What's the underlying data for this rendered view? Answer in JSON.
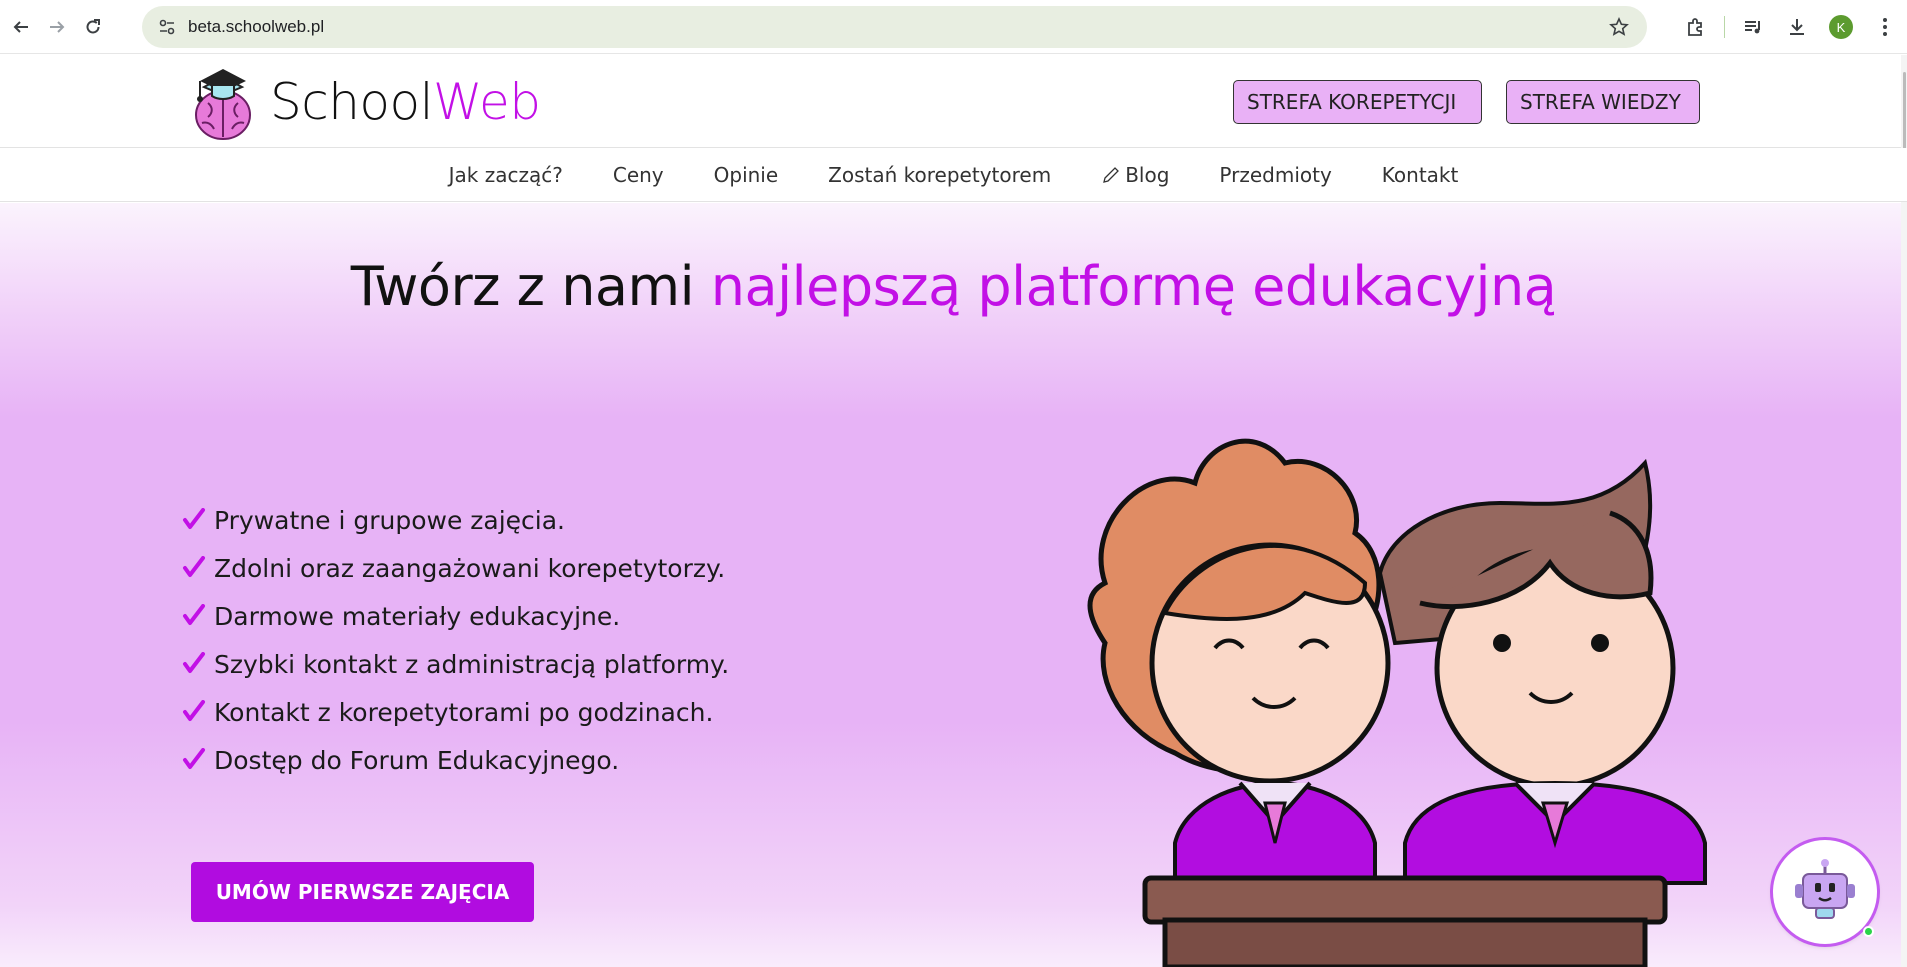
{
  "browser": {
    "url": "beta.schoolweb.pl",
    "profile_initial": "K"
  },
  "header": {
    "logo_part1": "School",
    "logo_part2": "Web",
    "zone_tutoring": "STREFA KOREPETYCJI",
    "zone_knowledge": "STREFA WIEDZY"
  },
  "nav": {
    "items": [
      "Jak zacząć?",
      "Ceny",
      "Opinie",
      "Zostań korepetytorem",
      "Blog",
      "Przedmioty",
      "Kontakt"
    ]
  },
  "hero": {
    "title_part1": "Twórz z nami ",
    "title_part2": "najlepszą platformę edukacyjną",
    "features": [
      "Prywatne i grupowe zajęcia.",
      "Zdolni oraz zaangażowani korepetytorzy.",
      "Darmowe materiały edukacyjne.",
      "Szybki kontakt z administracją platformy.",
      "Kontakt z korepetytorami po godzinach.",
      "Dostęp do Forum Edukacyjnego."
    ],
    "cta_label": "UMÓW PIERWSZE ZAJĘCIA"
  },
  "colors": {
    "brand_accent": "#c210e6",
    "cta_bg": "#b10ce0",
    "zone_button_bg": "#e9b1f6",
    "hero_bg": "#e7b3f6"
  },
  "icons": {
    "back": "arrow-left-icon",
    "forward": "arrow-right-icon",
    "reload": "reload-icon",
    "site_info": "tune-icon",
    "bookmark": "star-icon",
    "extensions": "puzzle-icon",
    "media": "media-control-icon",
    "downloads": "download-icon",
    "menu": "kebab-menu-icon",
    "blog": "pencil-icon",
    "check": "checkmark-icon",
    "chatbot": "robot-icon"
  }
}
